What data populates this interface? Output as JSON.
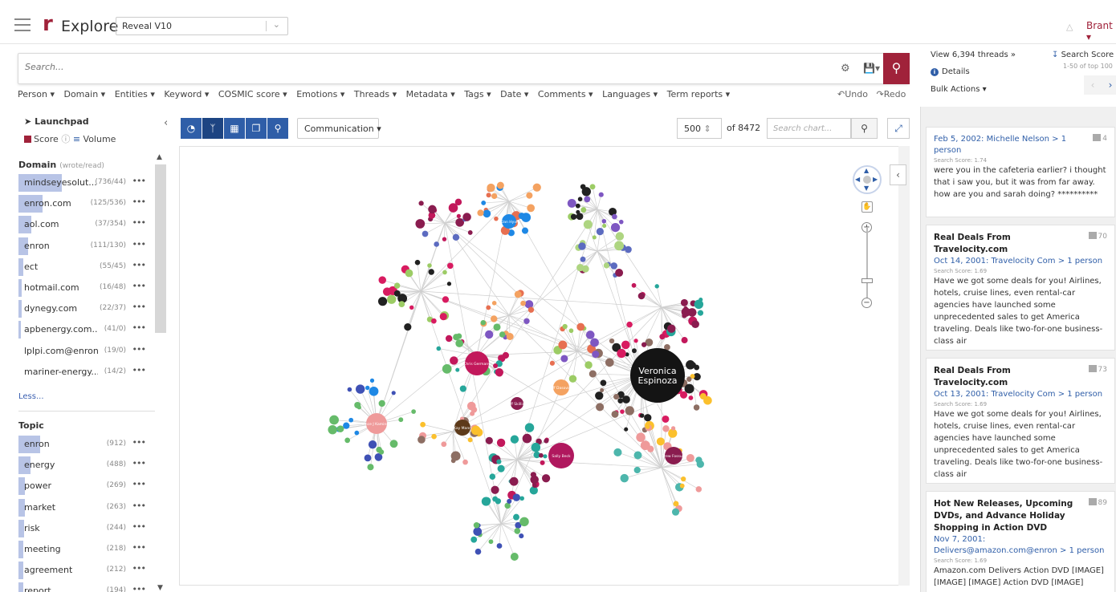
{
  "app": {
    "logo": "r",
    "title": "Explore",
    "project": "Reveal V10",
    "user": "Brant"
  },
  "search": {
    "placeholder": "Search..."
  },
  "filters": [
    "Person ▾",
    "Domain ▾",
    "Entities ▾",
    "Keyword ▾",
    "COSMIC score ▾",
    "Emotions ▾",
    "Threads ▾",
    "Metadata ▾",
    "Tags ▾",
    "Date ▾",
    "Comments ▾",
    "Languages ▾",
    "Term reports ▾"
  ],
  "undo_label": "Undo",
  "redo_label": "Redo",
  "launchpad": {
    "title": "Launchpad",
    "score_label": "Score",
    "volume_label": "Volume"
  },
  "domain_facet": {
    "title": "Domain",
    "subtitle": "(wrote/read)",
    "items": [
      {
        "label": "mindseyesolut...",
        "count": "(736/44)",
        "fill": 1.0
      },
      {
        "label": "enron.com",
        "count": "(125/536)",
        "fill": 0.55
      },
      {
        "label": "aol.com",
        "count": "(37/354)",
        "fill": 0.3
      },
      {
        "label": "enron",
        "count": "(111/130)",
        "fill": 0.22
      },
      {
        "label": "ect",
        "count": "(55/45)",
        "fill": 0.12
      },
      {
        "label": "hotmail.com",
        "count": "(16/48)",
        "fill": 0.07
      },
      {
        "label": "dynegy.com",
        "count": "(22/37)",
        "fill": 0.07
      },
      {
        "label": "apbenergy.com...",
        "count": "(41/0)",
        "fill": 0.05
      },
      {
        "label": "lplpi.com@enron",
        "count": "(19/0)",
        "fill": 0.0
      },
      {
        "label": "mariner-energy....",
        "count": "(14/2)",
        "fill": 0.0
      }
    ],
    "less_label": "Less..."
  },
  "topic_facet": {
    "title": "Topic",
    "items": [
      {
        "label": "enron",
        "count": "(912)",
        "fill": 0.5
      },
      {
        "label": "energy",
        "count": "(488)",
        "fill": 0.27
      },
      {
        "label": "power",
        "count": "(269)",
        "fill": 0.15
      },
      {
        "label": "market",
        "count": "(263)",
        "fill": 0.14
      },
      {
        "label": "risk",
        "count": "(244)",
        "fill": 0.13
      },
      {
        "label": "meeting",
        "count": "(218)",
        "fill": 0.12
      },
      {
        "label": "agreement",
        "count": "(212)",
        "fill": 0.12
      },
      {
        "label": "report",
        "count": "(194)",
        "fill": 0.11
      }
    ]
  },
  "chart_toolbar": {
    "view_select": "Communication ▾",
    "node_count": "500",
    "of_total": "of 8472",
    "search_placeholder": "Search chart..."
  },
  "graph": {
    "main_node": "Veronica Espinoza",
    "hub_labels": [
      "Chris Germany",
      "Sally Beck",
      "Drew Fossum",
      "Vince J Kaminski",
      "Jeff Dasovich",
      "Dan Hyvl",
      "Kay Mann",
      "Jeff Skilling"
    ]
  },
  "right_panel": {
    "view_threads": "View 6,394 threads »",
    "sort_label": "Search Score",
    "range_label": "1-50 of top 100",
    "details_label": "Details",
    "bulk_label": "Bulk Actions ▾",
    "cards": [
      {
        "date_line": "Feb 5, 2002: Michelle Nelson > 1 person",
        "subject": "",
        "score": "Search Score: 1.74",
        "body": "were you in the cafeteria earlier? i thought that i saw you, but it was from far away. how are you and sarah doing? **********",
        "count": "4"
      },
      {
        "date_line": "Oct 14, 2001: Travelocity Com > 1 person",
        "subject": "Real Deals From Travelocity.com",
        "score": "Search Score: 1.69",
        "body": "Have we got some deals for you! Airlines, hotels, cruise lines, even rental-car agencies have launched some unprecedented sales to get America traveling. Deals like two-for-one business-class air",
        "count": "70"
      },
      {
        "date_line": "Oct 13, 2001: Travelocity Com > 1 person",
        "subject": "Real Deals From Travelocity.com",
        "score": "Search Score: 1.69",
        "body": "Have we got some deals for you! Airlines, hotels, cruise lines, even rental-car agencies have launched some unprecedented sales to get America traveling. Deals like two-for-one business-class air",
        "count": "73"
      },
      {
        "date_line": "Nov 7, 2001: Delivers@amazon.com@enron > 1 person",
        "subject": "Hot New Releases, Upcoming DVDs, and Advance Holiday Shopping in Action DVD",
        "score": "Search Score: 1.69",
        "body": "Amazon.com Delivers Action DVD [IMAGE] [IMAGE] [IMAGE] Action DVD [IMAGE]",
        "count": "89"
      }
    ]
  },
  "colors": {
    "brand": "#a0223a",
    "primary": "#2f5ea8",
    "facet_bar": "#b8c4e6"
  }
}
